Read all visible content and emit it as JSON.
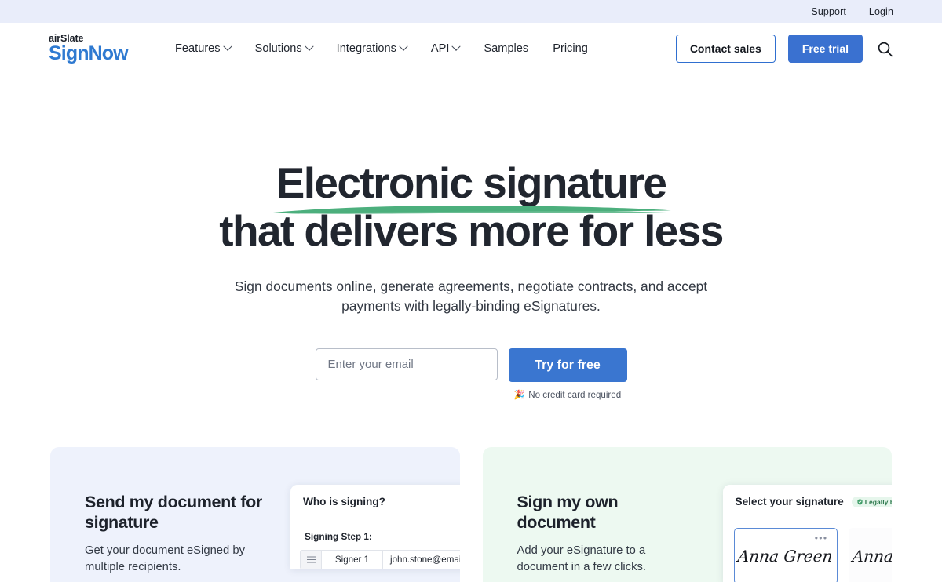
{
  "utility": {
    "links": [
      {
        "label": "Support"
      },
      {
        "label": "Login"
      }
    ]
  },
  "header": {
    "logo": {
      "top": "airSlate",
      "main": "SignNow"
    },
    "nav": [
      {
        "label": "Features",
        "has_chevron": true
      },
      {
        "label": "Solutions",
        "has_chevron": true
      },
      {
        "label": "Integrations",
        "has_chevron": true
      },
      {
        "label": "API",
        "has_chevron": true
      },
      {
        "label": "Samples",
        "has_chevron": false
      },
      {
        "label": "Pricing",
        "has_chevron": false
      }
    ],
    "contact_sales_label": "Contact sales",
    "free_trial_label": "Free trial",
    "search_icon": "search-icon"
  },
  "hero": {
    "heading_line1": "Electronic signature",
    "heading_line2": "that delivers more for less",
    "subheading": "Sign documents online, generate agreements, negotiate contracts, and accept payments with legally-binding eSignatures.",
    "email_placeholder": "Enter your email",
    "email_value": "",
    "cta_label": "Try for free",
    "note_emoji": "🎉",
    "note": "No credit card required",
    "underline_color": "#4caf7d"
  },
  "cards": [
    {
      "title": "Send my document for signature",
      "description": "Get your document eSigned by multiple recipients.",
      "background": "#eef2fc",
      "mock": {
        "title": "Who is signing?",
        "step_label": "Signing Step 1:",
        "signer_name": "Signer 1",
        "signer_email": "john.stone@email.com"
      }
    },
    {
      "title": "Sign my own document",
      "description": "Add your eSignature to a document in a few clicks.",
      "background": "#edf9f1",
      "mock": {
        "title": "Select your signature",
        "badge": "Legally binding",
        "signatures": [
          {
            "name": "Anna Green",
            "selected": true
          },
          {
            "name": "Anna Green",
            "selected": false
          }
        ]
      }
    }
  ],
  "colors": {
    "brand_blue": "#3a71d0",
    "logo_blue": "#2f7ad1",
    "accent_green": "#4caf7d",
    "utility_bar": "#e9edfa"
  }
}
